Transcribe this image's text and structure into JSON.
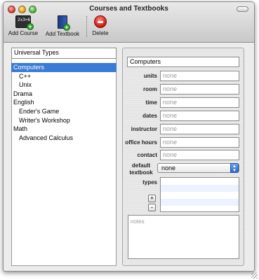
{
  "window": {
    "title": "Courses and Textbooks"
  },
  "toolbar": {
    "add_course_label": "Add Course",
    "add_course_icon_text": "2x3=6",
    "add_textbook_label": "Add Textbook",
    "delete_label": "Delete"
  },
  "left": {
    "filter_value": "Universal Types",
    "items": [
      {
        "label": "Computers",
        "level": 0,
        "selected": true
      },
      {
        "label": "C++",
        "level": 1
      },
      {
        "label": "Unix",
        "level": 1
      },
      {
        "label": "Drama",
        "level": 0
      },
      {
        "label": "English",
        "level": 0
      },
      {
        "label": "Ender's Game",
        "level": 1
      },
      {
        "label": "Writer's Workshop",
        "level": 1
      },
      {
        "label": "Math",
        "level": 0
      },
      {
        "label": "Advanced Calculus",
        "level": 1
      }
    ]
  },
  "detail": {
    "name_value": "Computers",
    "fields": [
      {
        "label": "units",
        "placeholder": "none"
      },
      {
        "label": "room",
        "placeholder": "none"
      },
      {
        "label": "time",
        "placeholder": "none"
      },
      {
        "label": "dates",
        "placeholder": "none"
      },
      {
        "label": "instructor",
        "placeholder": "none"
      },
      {
        "label": "office hours",
        "placeholder": "none"
      },
      {
        "label": "contact",
        "placeholder": "none"
      }
    ],
    "default_textbook_label": "default textbook",
    "default_textbook_value": "none",
    "types_label": "types",
    "add_type": "+",
    "remove_type": "-",
    "notes_placeholder": "notes"
  },
  "colors": {
    "selection": "#3a7bd5"
  }
}
